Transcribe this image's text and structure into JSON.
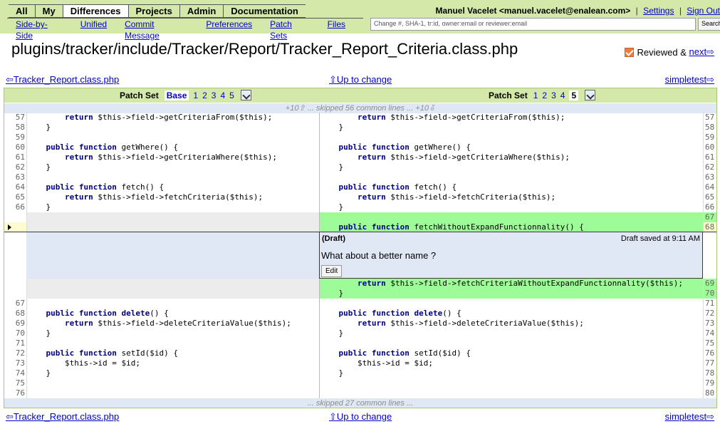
{
  "menu": {
    "items": [
      {
        "label": "All",
        "selected": false
      },
      {
        "label": "My",
        "selected": false
      },
      {
        "label": "Differences",
        "selected": true
      },
      {
        "label": "Projects",
        "selected": false
      },
      {
        "label": "Admin",
        "selected": false
      },
      {
        "label": "Documentation",
        "selected": false
      }
    ]
  },
  "submenu": {
    "items": [
      "Side-by-Side",
      "Unified",
      "Commit Message",
      "Preferences",
      "Patch Sets",
      "Files"
    ]
  },
  "user": {
    "name": "Manuel Vacelet <manuel.vacelet@enalean.com>",
    "settings": "Settings",
    "signout": "Sign Out"
  },
  "search": {
    "placeholder": "Change #, SHA-1, tr:id, owner:email or reviewer:email",
    "button": "Search"
  },
  "file": {
    "path": "plugins/tracker/include/Tracker/Report/Tracker_Report_Criteria.class.php",
    "reviewed_label": "Reviewed &",
    "next_label": "next⇨"
  },
  "nav": {
    "prev": "⇦Tracker_Report.class.php",
    "up": "⇧Up to change",
    "next": "simpletest⇨"
  },
  "patchsets": {
    "label": "Patch Set",
    "left": [
      "Base",
      "1",
      "2",
      "3",
      "4",
      "5"
    ],
    "right": [
      "1",
      "2",
      "3",
      "4",
      "5"
    ],
    "left_selected": "Base",
    "right_selected": "5"
  },
  "skip_top": "+10⇧ ... skipped 56 common lines ... +10⇩",
  "skip_bottom": "... skipped 27 common lines ...",
  "lines_top": [
    {
      "l": "57",
      "r": "57",
      "left": "        return $this->field->getCriteriaFrom($this);",
      "right": "        return $this->field->getCriteriaFrom($this);"
    },
    {
      "l": "58",
      "r": "58",
      "left": "    }",
      "right": "    }"
    },
    {
      "l": "59",
      "r": "59",
      "left": "",
      "right": ""
    },
    {
      "l": "60",
      "r": "60",
      "left": "    public function getWhere() {",
      "right": "    public function getWhere() {"
    },
    {
      "l": "61",
      "r": "61",
      "left": "        return $this->field->getCriteriaWhere($this);",
      "right": "        return $this->field->getCriteriaWhere($this);"
    },
    {
      "l": "62",
      "r": "62",
      "left": "    }",
      "right": "    }"
    },
    {
      "l": "63",
      "r": "63",
      "left": "",
      "right": ""
    },
    {
      "l": "64",
      "r": "64",
      "left": "    public function fetch() {",
      "right": "    public function fetch() {"
    },
    {
      "l": "65",
      "r": "65",
      "left": "        return $this->field->fetchCriteria($this);",
      "right": "        return $this->field->fetchCriteria($this);"
    },
    {
      "l": "66",
      "r": "66",
      "left": "    }",
      "right": "    }"
    },
    {
      "l": "",
      "r": "67",
      "left": "",
      "right": "",
      "ins": true
    },
    {
      "l": "",
      "r": "68",
      "left": "",
      "right": "    public function fetchWithoutExpandFunctionnality() {",
      "ins": true,
      "cursor": true
    }
  ],
  "comment": {
    "head": "(Draft)",
    "time": "Draft saved at 9:11 AM",
    "body": "What about a better name ?",
    "edit": "Edit"
  },
  "lines_bottom": [
    {
      "l": "",
      "r": "69",
      "left": "",
      "right": "        return $this->field->fetchCriteriaWithoutExpandFunctionnality($this);",
      "ins": true
    },
    {
      "l": "",
      "r": "70",
      "left": "",
      "right": "    }",
      "ins": true
    },
    {
      "l": "67",
      "r": "71",
      "left": "",
      "right": ""
    },
    {
      "l": "68",
      "r": "72",
      "left": "    public function delete() {",
      "right": "    public function delete() {"
    },
    {
      "l": "69",
      "r": "73",
      "left": "        return $this->field->deleteCriteriaValue($this);",
      "right": "        return $this->field->deleteCriteriaValue($this);"
    },
    {
      "l": "70",
      "r": "74",
      "left": "    }",
      "right": "    }"
    },
    {
      "l": "71",
      "r": "75",
      "left": "",
      "right": ""
    },
    {
      "l": "72",
      "r": "76",
      "left": "    public function setId($id) {",
      "right": "    public function setId($id) {"
    },
    {
      "l": "73",
      "r": "77",
      "left": "        $this->id = $id;",
      "right": "        $this->id = $id;"
    },
    {
      "l": "74",
      "r": "78",
      "left": "    }",
      "right": "    }"
    },
    {
      "l": "75",
      "r": "79",
      "left": "",
      "right": ""
    },
    {
      "l": "76",
      "r": "80",
      "left": "",
      "right": ""
    }
  ]
}
